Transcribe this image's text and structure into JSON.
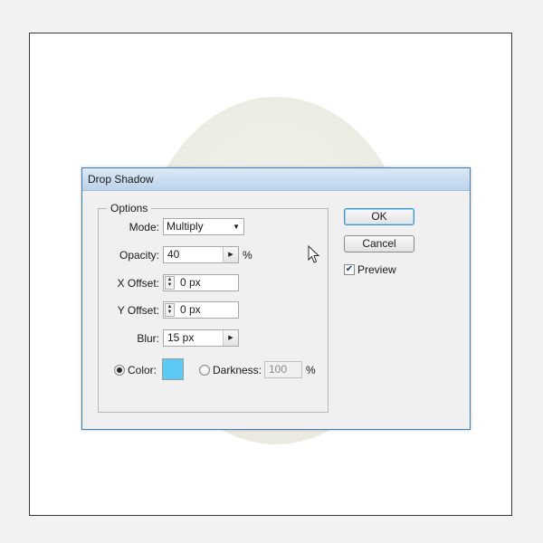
{
  "dialog": {
    "title": "Drop Shadow"
  },
  "options": {
    "legend": "Options",
    "mode": {
      "label": "Mode:",
      "value": "Multiply"
    },
    "opacity": {
      "label": "Opacity:",
      "value": "40",
      "unit": "%"
    },
    "x_offset": {
      "label": "X Offset:",
      "value": "0 px"
    },
    "y_offset": {
      "label": "Y Offset:",
      "value": "0 px"
    },
    "blur": {
      "label": "Blur:",
      "value": "15 px"
    },
    "color": {
      "label": "Color:",
      "selected": true,
      "swatch": "#5bcbf5"
    },
    "darkness": {
      "label": "Darkness:",
      "value": "100",
      "unit": "%",
      "selected": false
    }
  },
  "buttons": {
    "ok": "OK",
    "cancel": "Cancel"
  },
  "preview": {
    "label": "Preview",
    "checked": true
  },
  "icons": {
    "dropdown": "chevron-down-icon",
    "stepper": "chevron-right-icon",
    "spinner": "up-down-spinner-icon",
    "checkmark": "check-icon",
    "cursor": "mouse-pointer-icon"
  },
  "colors": {
    "accent": "#3d8fc9",
    "swatch": "#5bcbf5",
    "circle": "#ecece3",
    "titlebar": "#c8dcef"
  }
}
